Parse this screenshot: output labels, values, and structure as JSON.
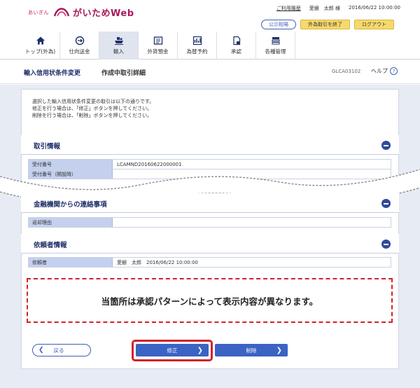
{
  "header": {
    "bank_name": "あいぎん",
    "app_name": "がいためWeb",
    "usage_history": "ご利用履歴",
    "user_name": "愛銀　太郎 様",
    "datetime": "2016/06/22 10:00:00",
    "btn_rates": "公示相場",
    "btn_end_fx": "外為取引を終了",
    "btn_logout": "ログアウト"
  },
  "nav": {
    "items": [
      {
        "label": "トップ(外為)",
        "icon": "home-icon"
      },
      {
        "label": "仕向送金",
        "icon": "remittance-icon"
      },
      {
        "label": "輸入",
        "icon": "ship-icon"
      },
      {
        "label": "外貨預金",
        "icon": "deposit-icon"
      },
      {
        "label": "為替予約",
        "icon": "contract-icon"
      },
      {
        "label": "承認",
        "icon": "approval-icon"
      },
      {
        "label": "各種管理",
        "icon": "management-icon"
      }
    ],
    "active_index": 2
  },
  "page": {
    "title": "輸入信用状条件変更",
    "subtitle": "作成中取引詳細",
    "screen_id": "GLCA03102",
    "help": "ヘルプ",
    "help_symbol": "?"
  },
  "intro": {
    "line1": "選択した輸入信用状条件変更の取引は以下の通りです。",
    "line2": "修正を行う場合は、「修正」ボタンを押してください。",
    "line3": "削除を行う場合は、「削除」ボタンを押してください。"
  },
  "sections": {
    "transaction": {
      "title": "取引情報",
      "rows": [
        {
          "label": "受付番号",
          "value": "LCAMND20160622000001"
        },
        {
          "label": "受付番号（開設時）",
          "value": ""
        }
      ]
    },
    "bank_notice": {
      "title": "金融機関からの連絡事項",
      "rows": [
        {
          "label": "返却理由",
          "value": ""
        }
      ]
    },
    "requester": {
      "title": "依頼者情報",
      "rows": [
        {
          "label": "依頼者",
          "value": "愛銀　太郎　2016/06/22 10:00:00"
        }
      ]
    }
  },
  "notice_text": "当箇所は承認パターンによって表示内容が異なります。",
  "buttons": {
    "back": "戻る",
    "edit": "修正",
    "delete": "削除"
  },
  "colors": {
    "brand": "#a81a5c",
    "primary_blue": "#3a63c4",
    "highlight_red": "#d2232a"
  }
}
